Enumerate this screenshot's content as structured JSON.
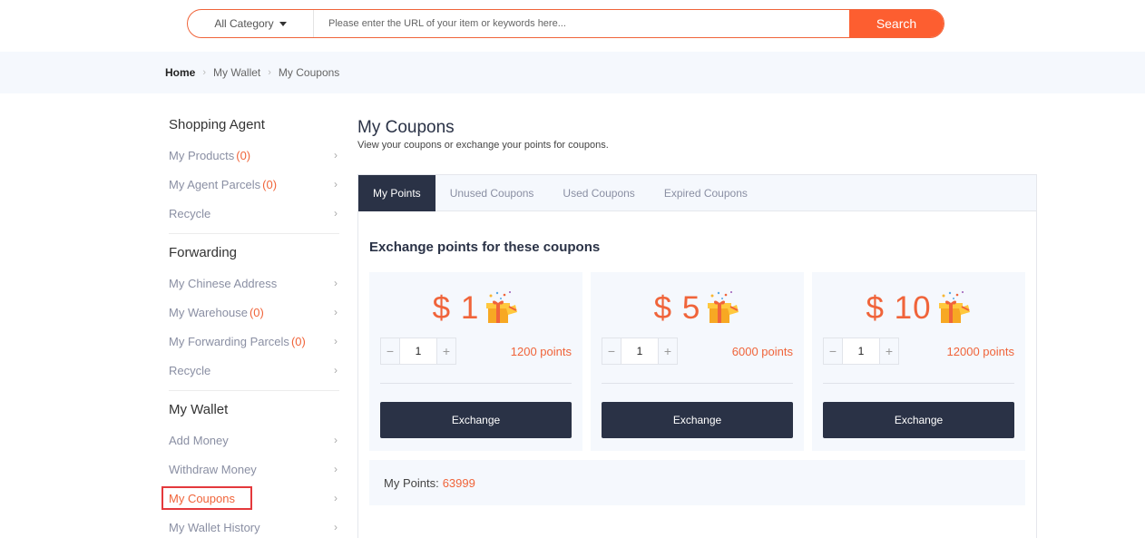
{
  "search": {
    "category_label": "All Category",
    "placeholder": "Please enter the URL of your item or keywords here...",
    "button_label": "Search"
  },
  "breadcrumb": [
    "Home",
    "My Wallet",
    "My Coupons"
  ],
  "sidebar": {
    "sections": [
      {
        "title": "Shopping Agent",
        "items": [
          {
            "label": "My Products",
            "count": "(0)"
          },
          {
            "label": "My Agent Parcels",
            "count": "(0)"
          },
          {
            "label": "Recycle",
            "count": ""
          }
        ]
      },
      {
        "title": "Forwarding",
        "items": [
          {
            "label": "My Chinese Address",
            "count": ""
          },
          {
            "label": "My Warehouse",
            "count": "(0)"
          },
          {
            "label": "My Forwarding Parcels",
            "count": "(0)"
          },
          {
            "label": "Recycle",
            "count": ""
          }
        ]
      },
      {
        "title": "My Wallet",
        "items": [
          {
            "label": "Add Money",
            "count": ""
          },
          {
            "label": "Withdraw Money",
            "count": ""
          },
          {
            "label": "My Coupons",
            "count": "",
            "active": true
          },
          {
            "label": "My Wallet History",
            "count": ""
          }
        ]
      }
    ]
  },
  "main": {
    "title": "My Coupons",
    "subtitle": "View your coupons or exchange your points for coupons.",
    "tabs": [
      "My Points",
      "Unused Coupons",
      "Used Coupons",
      "Expired Coupons"
    ],
    "active_tab": 0,
    "section_heading": "Exchange points for these coupons",
    "coupons": [
      {
        "amount": "$ 1",
        "quantity": "1",
        "points": "1200 points",
        "button": "Exchange"
      },
      {
        "amount": "$ 5",
        "quantity": "1",
        "points": "6000 points",
        "button": "Exchange"
      },
      {
        "amount": "$ 10",
        "quantity": "1",
        "points": "12000 points",
        "button": "Exchange"
      }
    ],
    "stepper_minus": "−",
    "stepper_plus": "+",
    "my_points_label": "My Points:",
    "my_points_value": "63999"
  },
  "colors": {
    "accent": "#f0643a",
    "dark": "#2a3246",
    "panel_bg": "#f5f8fd"
  }
}
